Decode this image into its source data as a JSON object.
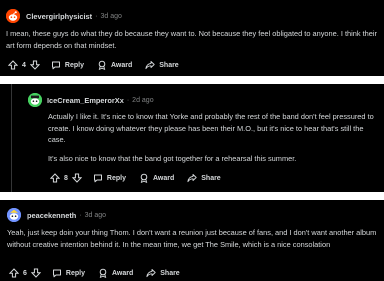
{
  "comments": [
    {
      "username": "Clevergirlphysicist",
      "separator": "·",
      "age": "3d ago",
      "paragraphs": [
        "I mean, these guys do what they do because they want to. Not because they feel obligated to anyone. I think their art form depends on that mindset."
      ],
      "score": "4",
      "actions": {
        "reply": "Reply",
        "award": "Award",
        "share": "Share"
      },
      "avatar_color": "#ff4500"
    },
    {
      "username": "IceCream_EmperorXx",
      "separator": "·",
      "age": "2d ago",
      "paragraphs": [
        "Actually I like it. It's nice to know that Yorke and probably the rest of the band don't feel pressured to create. I know doing whatever they please has been their M.O., but it's nice to hear that's still the case.",
        "It's also nice to know that the band got together for a rehearsal this summer."
      ],
      "score": "8",
      "actions": {
        "reply": "Reply",
        "award": "Award",
        "share": "Share"
      },
      "avatar_color": "#46d160"
    },
    {
      "username": "peacekenneth",
      "separator": "·",
      "age": "3d ago",
      "paragraphs": [
        "Yeah, just keep doin your thing Thom. I don't want a reunion just because of fans, and I don't want another album without creative intention behind it. In the mean time, we get The Smile, which is a nice consolation"
      ],
      "score": "6",
      "actions": {
        "reply": "Reply",
        "award": "Award",
        "share": "Share"
      },
      "avatar_color": "#7193ff"
    }
  ],
  "colors": {
    "background": "#000000",
    "text": "#d7dadc",
    "meta": "#818384",
    "gap": "#ffffff"
  }
}
